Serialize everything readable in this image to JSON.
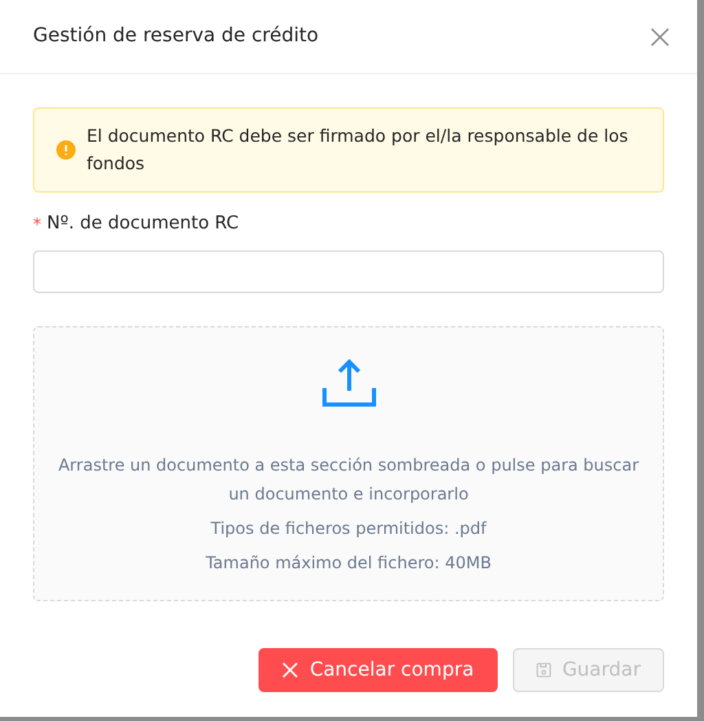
{
  "dialog": {
    "title": "Gestión de reserva de crédito"
  },
  "alert": {
    "text": "El documento RC debe ser firmado por el/la responsable de los fondos"
  },
  "field": {
    "label": "Nº. de documento RC",
    "required_mark": "*"
  },
  "dropzone": {
    "lines": [
      "Arrastre un documento a esta sección sombreada o pulse para buscar un documento e incorporarlo",
      "Tipos de ficheros permitidos: .pdf",
      "Tamaño máximo del fichero: 40MB"
    ]
  },
  "buttons": [
    {
      "kind": "danger",
      "label": "Cancelar compra",
      "disabled": false
    },
    {
      "kind": "save",
      "label": "Guardar",
      "disabled": true
    }
  ]
}
